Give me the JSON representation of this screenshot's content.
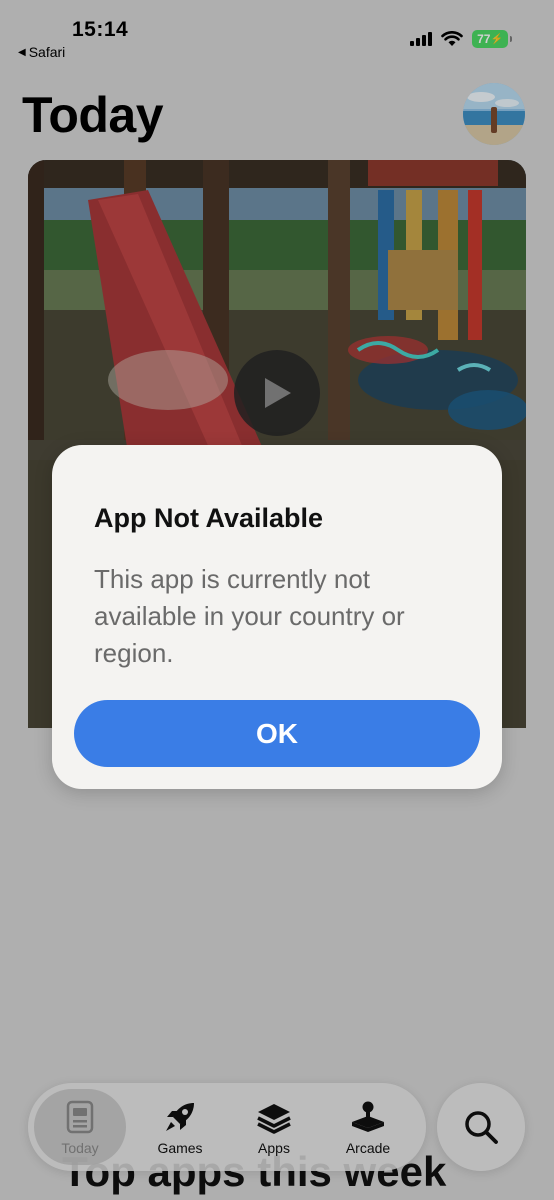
{
  "status_bar": {
    "time": "15:14",
    "back_label": "Safari",
    "battery": "77"
  },
  "header": {
    "title": "Today"
  },
  "alert": {
    "title": "App Not Available",
    "message": "This app is currently not available in your country or region.",
    "ok_label": "OK"
  },
  "content_behind": {
    "heading": "Top apps this week"
  },
  "tab_bar": {
    "items": [
      {
        "label": "Today",
        "icon": "today-icon",
        "active": true
      },
      {
        "label": "Games",
        "icon": "rocket-icon",
        "active": false
      },
      {
        "label": "Apps",
        "icon": "layers-icon",
        "active": false
      },
      {
        "label": "Arcade",
        "icon": "joystick-icon",
        "active": false
      }
    ],
    "search_icon": "search-icon"
  },
  "colors": {
    "accent": "#3a7de6",
    "battery": "#4cd964"
  }
}
